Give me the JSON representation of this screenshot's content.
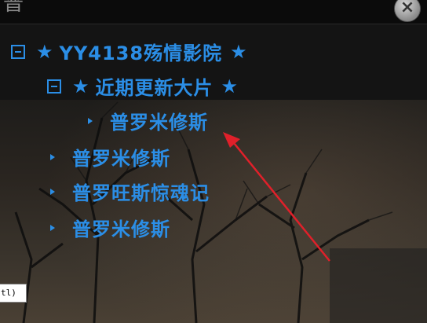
{
  "window": {
    "title": "普",
    "close_symbol": "×"
  },
  "tree": {
    "root": {
      "label": "YY4138殇情影院",
      "star": "★"
    },
    "group": {
      "label": "近期更新大片",
      "star": "★",
      "children": [
        {
          "label": "普罗米修斯"
        }
      ]
    },
    "items": [
      {
        "label": "普罗米修斯"
      },
      {
        "label": "普罗旺斯惊魂记"
      },
      {
        "label": "普罗米修斯"
      }
    ]
  },
  "tooltip": {
    "text": "tl)"
  },
  "colors": {
    "tree_text": "#2b8ee6",
    "annotation_arrow": "#e0202a"
  }
}
